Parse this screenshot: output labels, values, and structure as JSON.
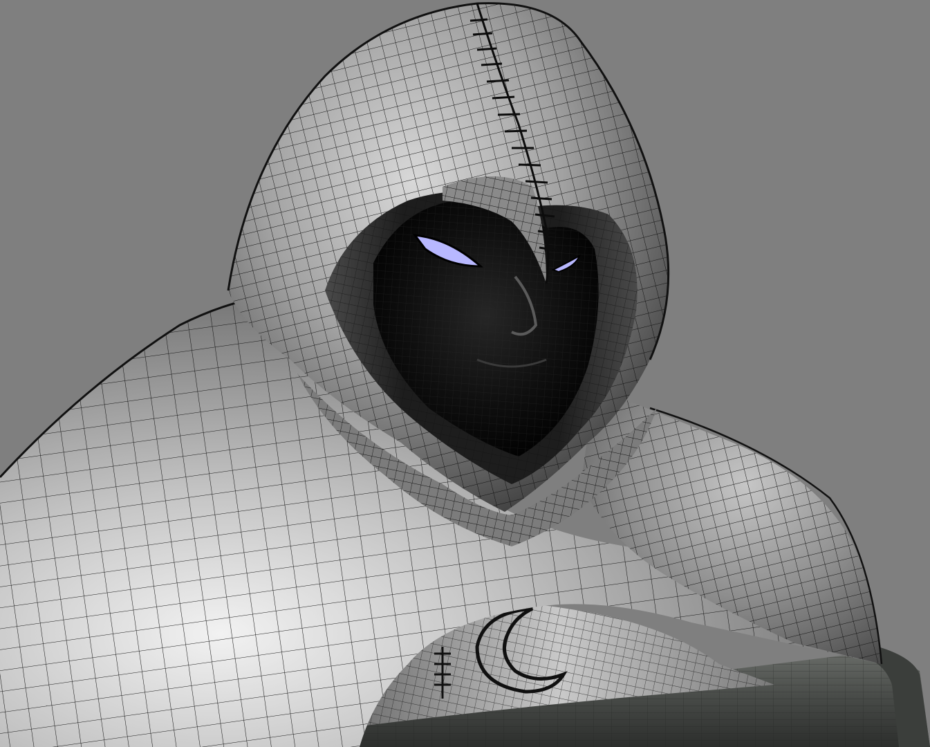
{
  "scene": {
    "subject": "hooded-figure-bust",
    "render_mode": "shaded-wireframe",
    "colors": {
      "background": "#7f7f7f",
      "cloth_light": "#e6e6e6",
      "cloth_mid": "#9a9a9a",
      "cloth_dark": "#3a3a3a",
      "face": "#0b0b0b",
      "eye_glow": "#b8b8ff",
      "wire": "#111111",
      "base_ring": "#4a4d4a"
    },
    "icons": {
      "emblem": "crescent-moon-icon",
      "stitch_seam": "stitched-seam-icon"
    }
  }
}
